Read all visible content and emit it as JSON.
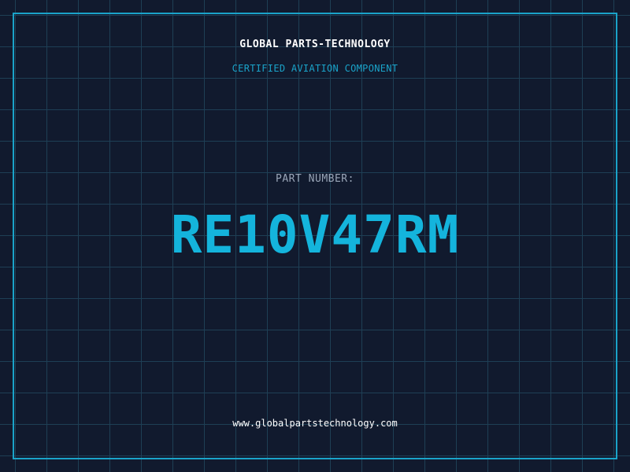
{
  "label": {
    "company_name": "GLOBAL PARTS-TECHNOLOGY",
    "tagline": "CERTIFIED AVIATION COMPONENT",
    "part_number_label": "PART NUMBER:",
    "part_number": "RE10V47RM",
    "website": "www.globalpartstechnology.com"
  },
  "colors": {
    "background": "#111a2e",
    "grid": "#1e3f55",
    "accent": "#1aa3c9",
    "part_number": "#14b4dc",
    "label_gray": "#9aa6b8",
    "text": "#ffffff"
  }
}
